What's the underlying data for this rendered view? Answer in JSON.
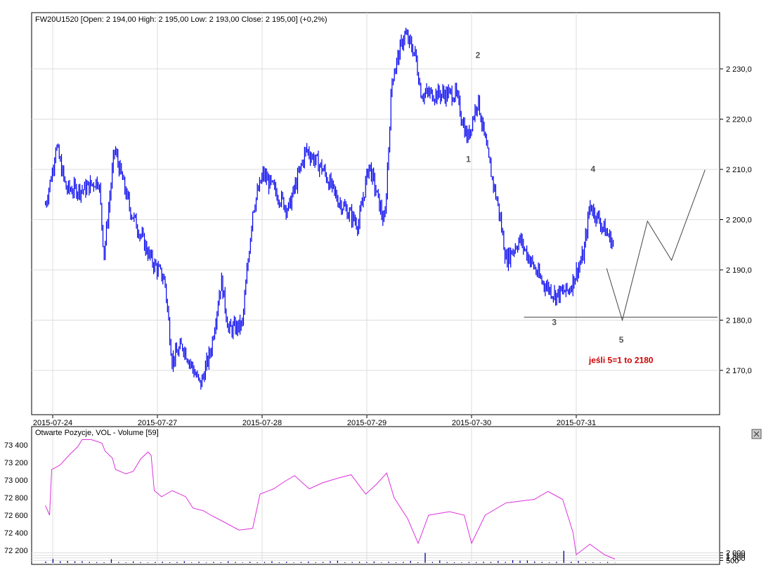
{
  "chart_data": [
    {
      "type": "ohlc",
      "title": "FW20U1520 [Open: 2 194,00  High: 2 195,00  Low: 2 193,00  Close: 2 195,00] (+0,2%)",
      "x_tick_labels": [
        "2015-07-24",
        "2015-07-27",
        "2015-07-28",
        "2015-07-29",
        "2015-07-30",
        "2015-07-31"
      ],
      "y_tick_labels": [
        "2 170,0",
        "2 180,0",
        "2 190,0",
        "2 200,0",
        "2 210,0",
        "2 220,0",
        "2 230,0"
      ],
      "y_ticks": [
        2170,
        2180,
        2190,
        2200,
        2210,
        2220,
        2230
      ],
      "ylim": [
        2163,
        2241
      ],
      "xlim": [
        -0.2,
        6.4
      ],
      "price_path": [
        [
          -0.07,
          2203
        ],
        [
          0,
          2210
        ],
        [
          0.03,
          2215
        ],
        [
          0.13,
          2206
        ],
        [
          0.3,
          2206
        ],
        [
          0.44,
          2208
        ],
        [
          0.49,
          2193
        ],
        [
          0.59,
          2214
        ],
        [
          0.74,
          2202
        ],
        [
          0.94,
          2192
        ],
        [
          1.07,
          2188
        ],
        [
          1.14,
          2172
        ],
        [
          1.24,
          2175
        ],
        [
          1.41,
          2167
        ],
        [
          1.51,
          2174
        ],
        [
          1.61,
          2188
        ],
        [
          1.68,
          2178
        ],
        [
          1.81,
          2179
        ],
        [
          1.91,
          2202
        ],
        [
          2.01,
          2209
        ],
        [
          2.25,
          2202
        ],
        [
          2.42,
          2214
        ],
        [
          2.58,
          2210
        ],
        [
          2.72,
          2204
        ],
        [
          2.92,
          2199
        ],
        [
          3.02,
          2211
        ],
        [
          3.17,
          2199
        ],
        [
          3.24,
          2228
        ],
        [
          3.36,
          2237
        ],
        [
          3.46,
          2233
        ],
        [
          3.52,
          2225
        ],
        [
          3.69,
          2225
        ],
        [
          3.85,
          2225
        ],
        [
          3.96,
          2216
        ],
        [
          4.06,
          2224
        ],
        [
          4.16,
          2212
        ],
        [
          4.26,
          2202
        ],
        [
          4.33,
          2192
        ],
        [
          4.46,
          2196
        ],
        [
          4.66,
          2188
        ],
        [
          4.8,
          2185
        ],
        [
          4.93,
          2186
        ],
        [
          5.07,
          2193
        ],
        [
          5.13,
          2203
        ],
        [
          5.27,
          2198
        ],
        [
          5.36,
          2195
        ]
      ],
      "projection": [
        [
          5.29,
          2190.3
        ],
        [
          5.44,
          2180
        ],
        [
          5.68,
          2199.7
        ],
        [
          5.91,
          2191.9
        ],
        [
          6.23,
          2209.9
        ]
      ],
      "support_line": {
        "price": 2180.6,
        "from": 4.5,
        "to": 6.35
      },
      "wave_labels": [
        {
          "text": "1",
          "x": 3.97,
          "y": 2211.5
        },
        {
          "text": "2",
          "x": 4.06,
          "y": 2232.2
        },
        {
          "text": "3",
          "x": 4.79,
          "y": 2179
        },
        {
          "text": "4",
          "x": 5.16,
          "y": 2209.5
        },
        {
          "text": "5",
          "x": 5.43,
          "y": 2175.5
        }
      ],
      "annotation": {
        "text": "jeśli 5=1 to 2180",
        "x": 5.12,
        "y": 2171.5,
        "color": "#cc0000"
      }
    },
    {
      "type": "line+bar",
      "title": "Otwarte Pozycje, VOL - Volume [59]",
      "left_ticks": [
        72200,
        72400,
        72600,
        72800,
        73000,
        73200,
        73400
      ],
      "left_tick_labels": [
        "72 200",
        "72 400",
        "72 600",
        "72 800",
        "73 000",
        "73 200",
        "73 400"
      ],
      "right_ticks": [
        500,
        1000,
        1500,
        2000
      ],
      "right_tick_labels": [
        "500",
        "1 000",
        "1 500",
        "2 000"
      ],
      "open_interest": [
        [
          -0.07,
          72710
        ],
        [
          -0.03,
          72600
        ],
        [
          -0.01,
          73120
        ],
        [
          0.07,
          73170
        ],
        [
          0.17,
          73300
        ],
        [
          0.24,
          73380
        ],
        [
          0.28,
          73460
        ],
        [
          0.37,
          73460
        ],
        [
          0.47,
          73420
        ],
        [
          0.5,
          73330
        ],
        [
          0.57,
          73250
        ],
        [
          0.6,
          73120
        ],
        [
          0.7,
          73070
        ],
        [
          0.77,
          73100
        ],
        [
          0.84,
          73240
        ],
        [
          0.91,
          73320
        ],
        [
          0.94,
          73280
        ],
        [
          0.97,
          72880
        ],
        [
          1.04,
          72810
        ],
        [
          1.14,
          72880
        ],
        [
          1.27,
          72810
        ],
        [
          1.34,
          72680
        ],
        [
          1.44,
          72650
        ],
        [
          1.51,
          72600
        ],
        [
          1.64,
          72520
        ],
        [
          1.78,
          72430
        ],
        [
          1.91,
          72450
        ],
        [
          1.98,
          72840
        ],
        [
          2.11,
          72900
        ],
        [
          2.21,
          72980
        ],
        [
          2.31,
          73050
        ],
        [
          2.45,
          72900
        ],
        [
          2.58,
          72970
        ],
        [
          2.72,
          73020
        ],
        [
          2.85,
          73060
        ],
        [
          2.99,
          72840
        ],
        [
          3.09,
          72950
        ],
        [
          3.19,
          73080
        ],
        [
          3.26,
          72800
        ],
        [
          3.39,
          72560
        ],
        [
          3.49,
          72280
        ],
        [
          3.59,
          72600
        ],
        [
          3.79,
          72640
        ],
        [
          3.93,
          72600
        ],
        [
          4.0,
          72280
        ],
        [
          4.13,
          72600
        ],
        [
          4.33,
          72740
        ],
        [
          4.6,
          72780
        ],
        [
          4.73,
          72870
        ],
        [
          4.87,
          72780
        ],
        [
          4.97,
          72400
        ],
        [
          5.0,
          72150
        ],
        [
          5.13,
          72270
        ],
        [
          5.27,
          72150
        ],
        [
          5.37,
          72100
        ]
      ],
      "volume": [
        300,
        800,
        350,
        400,
        330,
        350,
        200,
        180,
        150,
        750,
        180,
        120,
        300,
        150,
        110,
        200,
        260,
        150,
        200,
        350,
        120,
        250,
        110,
        200,
        150,
        350,
        200,
        110,
        250,
        140,
        200,
        350,
        140,
        250,
        120,
        200,
        300,
        150,
        200,
        350,
        450,
        150,
        200,
        250,
        180,
        300,
        110,
        250,
        150,
        200,
        400,
        150,
        2000,
        200,
        500,
        180,
        150,
        120,
        200,
        180,
        250,
        200,
        400,
        200,
        550,
        450,
        500,
        300,
        200,
        150,
        250,
        2400,
        250,
        400,
        200,
        150,
        100,
        200,
        60
      ]
    }
  ],
  "ui": {
    "close_icon": "x-icon"
  }
}
